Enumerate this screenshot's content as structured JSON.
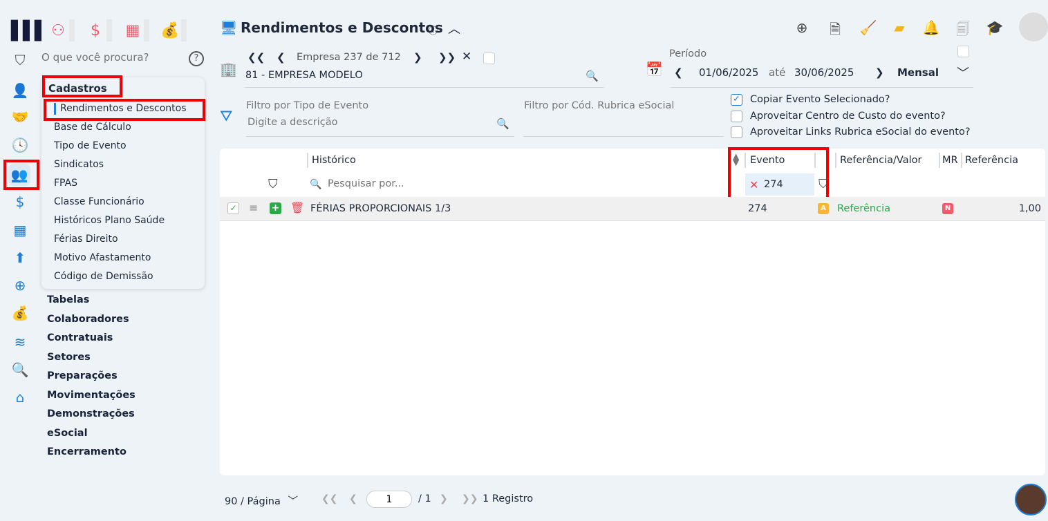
{
  "header": {
    "title": "Rendimentos e Descontos"
  },
  "search": {
    "placeholder": "O que você procura?"
  },
  "menu": {
    "section": "Cadastros",
    "items": [
      "Rendimentos e Descontos",
      "Base de Cálculo",
      "Tipo de Evento",
      "Sindicatos",
      "FPAS",
      "Classe Funcionário",
      "Históricos Plano Saúde",
      "Férias Direito",
      "Motivo Afastamento",
      "Código de Demissão"
    ]
  },
  "sections": [
    "Tabelas",
    "Colaboradores",
    "Contratuais",
    "Setores",
    "Preparações",
    "Movimentações",
    "Demonstrações",
    "eSocial",
    "Encerramento"
  ],
  "empresa": {
    "nav_label": "Empresa",
    "current": "237",
    "de": "de",
    "total": "712",
    "value": "81 - EMPRESA MODELO"
  },
  "periodo": {
    "label": "Período",
    "start": "01/06/2025",
    "ate": "até",
    "end": "30/06/2025",
    "type": "Mensal"
  },
  "filters": {
    "tipo_label": "Filtro por Tipo de Evento",
    "tipo_placeholder": "Digite a descrição",
    "rubrica_label": "Filtro por Cód. Rubrica eSocial"
  },
  "options": [
    {
      "label": "Copiar Evento Selecionado?",
      "checked": true
    },
    {
      "label": "Aproveitar Centro de Custo do evento?",
      "checked": false
    },
    {
      "label": "Aproveitar Links Rubrica eSocial do evento?",
      "checked": false
    }
  ],
  "table": {
    "columns": [
      "Histórico",
      "Evento",
      "Referência/Valor",
      "MR",
      "Referência"
    ],
    "search_placeholder": "Pesquisar por...",
    "evento_filter": "274",
    "rows": [
      {
        "historico": "FÉRIAS PROPORCIONAIS 1/3",
        "evento": "274",
        "badge": "A",
        "ref_valor": "Referência",
        "mr": "N",
        "referencia": "1,00"
      }
    ]
  },
  "pagination": {
    "per_page": "90 / Página",
    "page": "1",
    "total_pages": "/ 1",
    "records": "1 Registro"
  },
  "colors": {
    "accent": "#1f7fd6",
    "red": "#ee0000",
    "green": "#2aa84a"
  }
}
